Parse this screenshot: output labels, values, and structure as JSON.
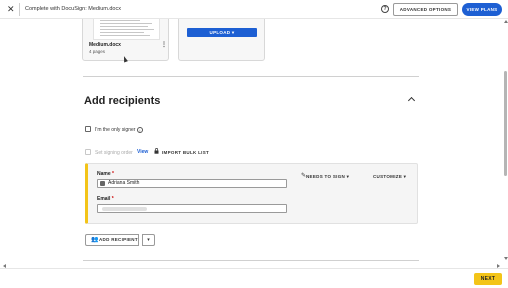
{
  "header": {
    "close_icon": "close-icon",
    "title": "Complete with DocuSign: Medium.docx",
    "help_icon": "help-icon",
    "advanced_options_label": "ADVANCED OPTIONS",
    "view_plans_label": "VIEW PLANS",
    "accent_color": "#1d5fd3"
  },
  "documents": [
    {
      "name": "Medium.docx",
      "pages": "4 pages"
    }
  ],
  "upload": {
    "label": "UPLOAD",
    "dropdown_icon": "caret-down-icon"
  },
  "recipients_section": {
    "title": "Add recipients",
    "collapse_icon": "chevron-up-icon",
    "only_signer_label": "I'm the only signer",
    "only_signer_checked": false,
    "signing_order_label": "Set signing order",
    "signing_order_enabled": false,
    "view_link": "View",
    "import_bulk_label": "IMPORT BULK LIST",
    "recipient": {
      "name_label": "Name",
      "required_marker": "*",
      "name_value": "Adriana Smith",
      "email_label": "Email",
      "email_value": "",
      "role_label": "NEEDS TO SIGN",
      "customize_label": "CUSTOMIZE",
      "accent_color": "#f3c418"
    },
    "add_recipient_label": "ADD RECIPIENT"
  },
  "footer": {
    "next_label": "NEXT",
    "next_color": "#f3c418"
  }
}
